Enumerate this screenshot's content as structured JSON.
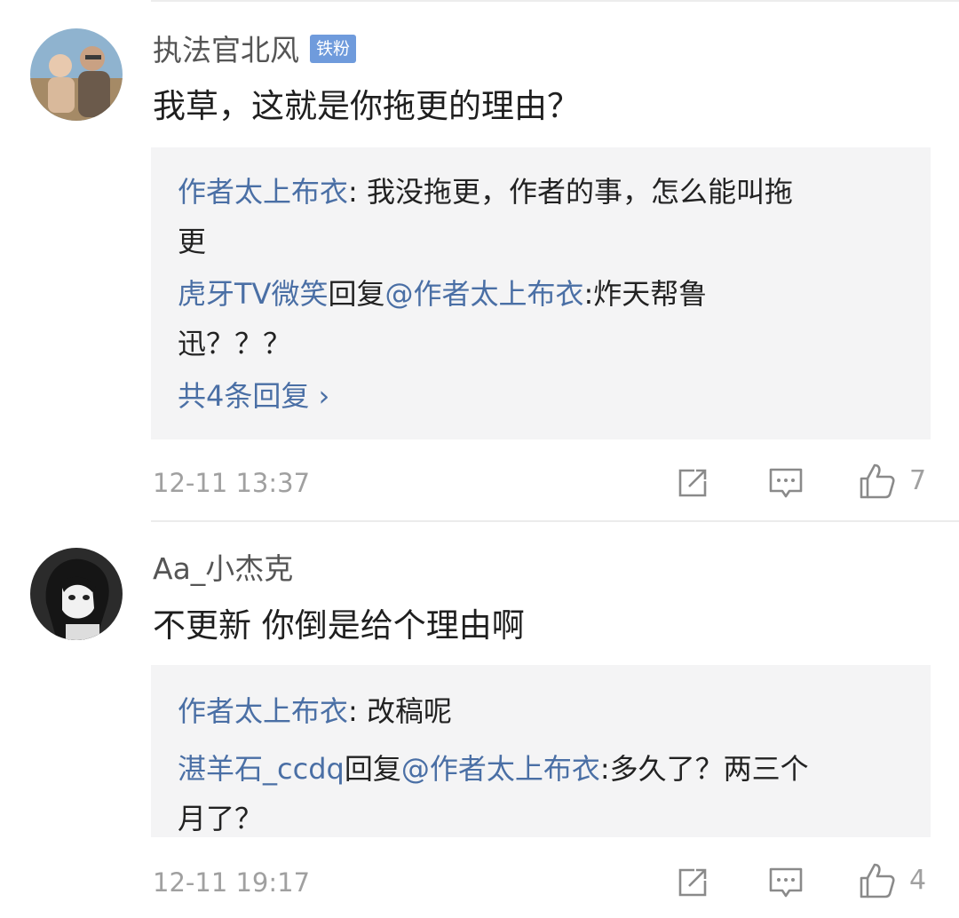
{
  "comments": [
    {
      "username": "执法官北风",
      "badge": "铁粉",
      "text": "我草，这就是你拖更的理由？",
      "replies": [
        {
          "name": "作者太上布衣",
          "line1": ": 我没拖更，作者的事，怎么能叫拖",
          "line2": "更"
        },
        {
          "name": "虎牙TV微笑",
          "mid": "回复",
          "target": "@作者太上布衣",
          "line1": ":炸天帮鲁",
          "line2": "迅？？？"
        }
      ],
      "more_replies": "共4条回复 ›",
      "time": "12-11 13:37",
      "likes": "7"
    },
    {
      "username": "Aa_小杰克",
      "text": "不更新 你倒是给个理由啊",
      "replies": [
        {
          "name": "作者太上布衣",
          "line1": ": 改稿呢"
        },
        {
          "name": "湛羊石_ccdq",
          "mid": "回复",
          "target": "@作者太上布衣",
          "line1": ":多久了？两三个",
          "line2": "月了？"
        }
      ],
      "time": "12-11 19:17",
      "likes": "4"
    }
  ],
  "icons": [
    "share-icon",
    "comment-icon",
    "thumbs-up-icon"
  ],
  "colors": {
    "link": "#4a6fa5",
    "badge": "#6f9bdc",
    "reply_bg": "#f4f4f5",
    "meta": "#a0a0a0"
  }
}
